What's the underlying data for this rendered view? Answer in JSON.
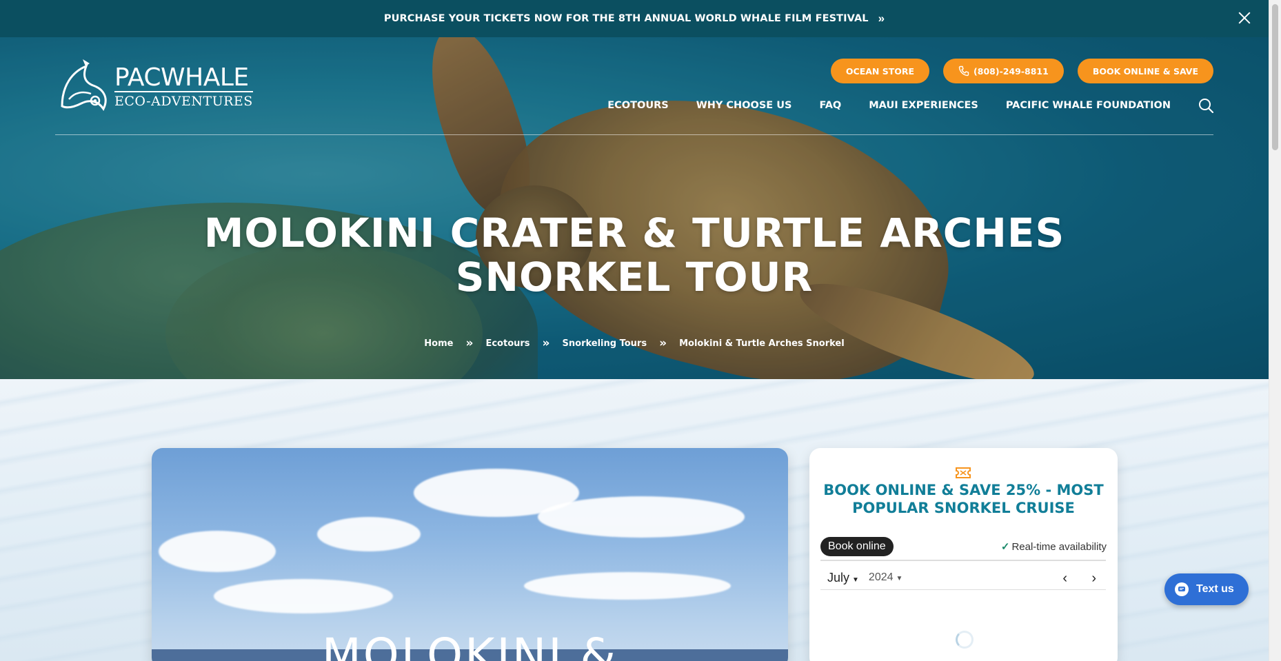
{
  "announcement": {
    "text": "PURCHASE YOUR TICKETS NOW FOR THE 8TH ANNUAL WORLD WHALE FILM FESTIVAL",
    "arrows": "»",
    "close_icon": "close-icon"
  },
  "logo": {
    "line1": "PACWHALE",
    "line2": "ECO-ADVENTURES"
  },
  "top_buttons": {
    "ocean_store": "OCEAN STORE",
    "phone": "(808)-249-8811",
    "book": "BOOK ONLINE & SAVE"
  },
  "nav": {
    "items": [
      "ECOTOURS",
      "WHY CHOOSE US",
      "FAQ",
      "MAUI EXPERIENCES",
      "PACIFIC WHALE FOUNDATION"
    ],
    "search_icon": "search-icon"
  },
  "hero": {
    "title_line1": "MOLOKINI CRATER & TURTLE ARCHES",
    "title_line2": "SNORKEL TOUR"
  },
  "breadcrumb": {
    "items": [
      "Home",
      "Ecotours",
      "Snorkeling Tours",
      "Molokini & Turtle Arches Snorkel"
    ],
    "separator": "»"
  },
  "photo_card": {
    "heading": "MOLOKINI &"
  },
  "booking": {
    "title": "BOOK ONLINE & SAVE 25% - MOST POPULAR SNORKEL CRUISE",
    "book_online_label": "Book online",
    "realtime_label": "Real-time availability",
    "month": "July",
    "year": "2024",
    "prev": "‹",
    "next": "›"
  },
  "text_us": {
    "label": "Text us"
  },
  "colors": {
    "accent_orange": "#f7941d",
    "announce_bg": "#0b4f60",
    "title_teal": "#117e98",
    "chat_blue": "#2e6fd6"
  }
}
